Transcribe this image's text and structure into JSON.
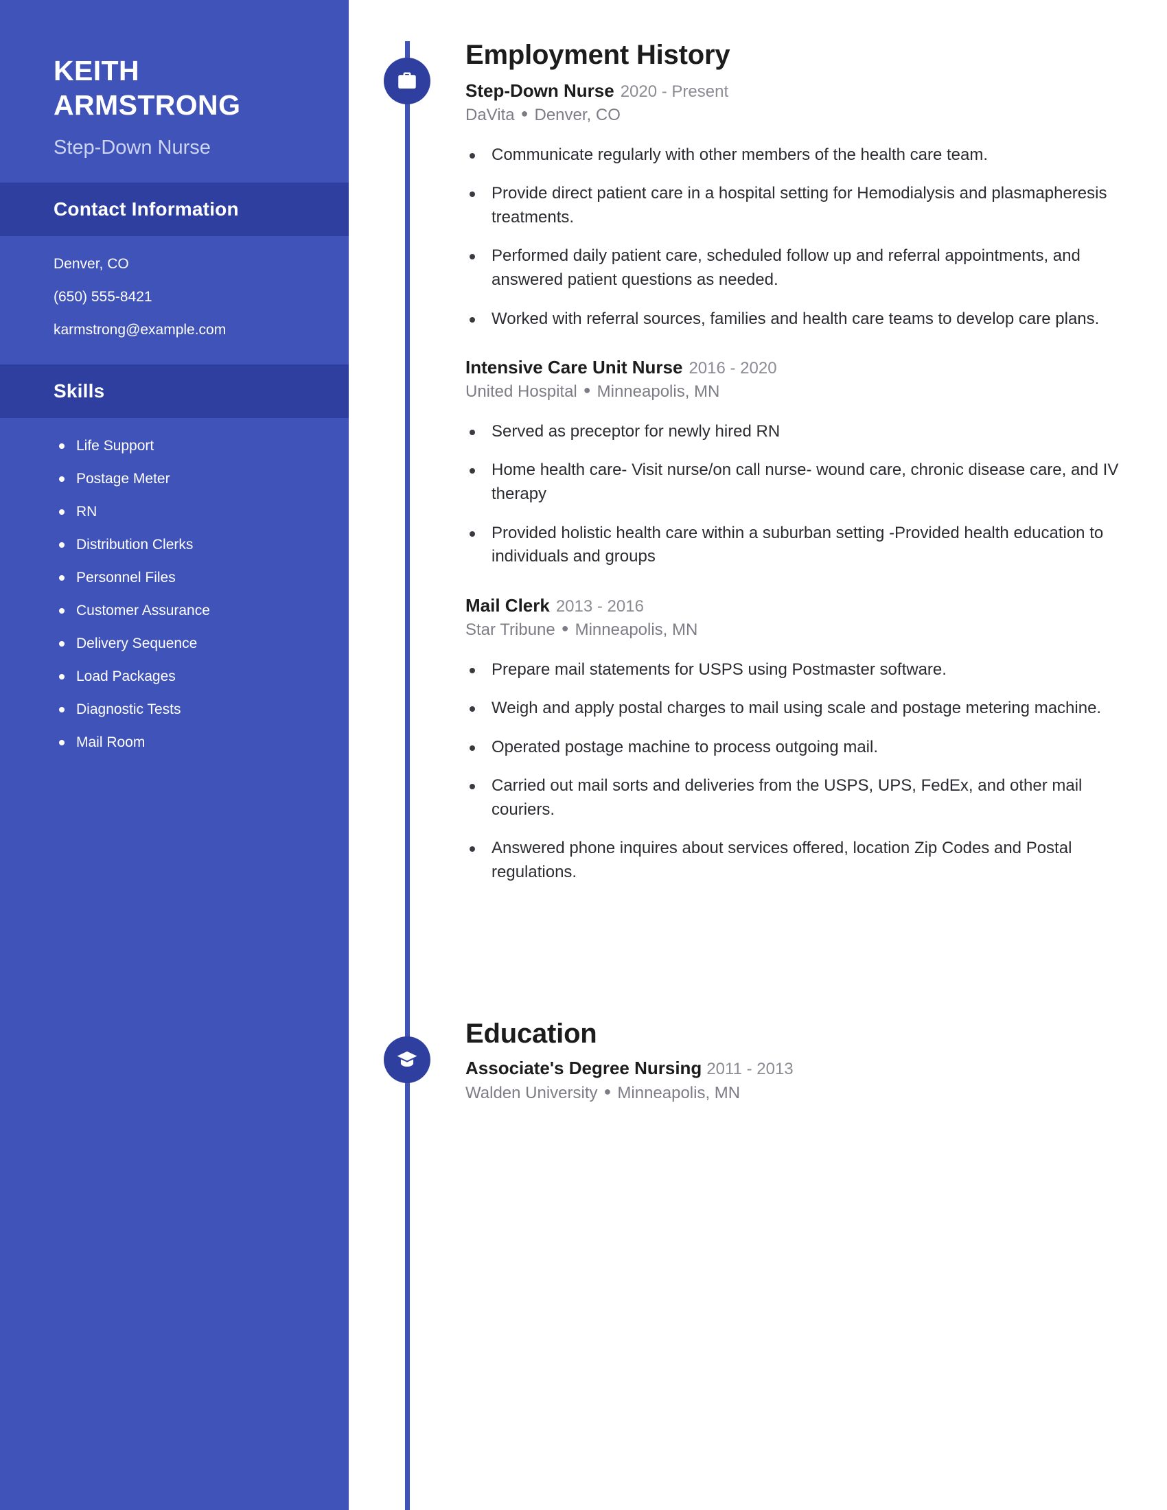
{
  "sidebar": {
    "name": "KEITH ARMSTRONG",
    "name_line_1": "KEITH",
    "name_line_2": "ARMSTRONG",
    "role": "Step-Down Nurse",
    "accent_color": "#4053b8",
    "band_color": "#2f3fa0",
    "contact": {
      "heading": "Contact Information",
      "lines": [
        "Denver, CO",
        "(650) 555-8421",
        "karmstrong@example.com"
      ]
    },
    "skills": {
      "heading": "Skills",
      "items": [
        "Life Support",
        "Postage Meter",
        "RN",
        "Distribution Clerks",
        "Personnel Files",
        "Customer Assurance",
        "Delivery Sequence",
        "Load Packages",
        "Diagnostic Tests",
        "Mail Room"
      ]
    }
  },
  "employment": {
    "heading": "Employment History",
    "icon": "briefcase-icon",
    "jobs": [
      {
        "title": "Step-Down Nurse",
        "dates": "2020 - Present",
        "company": "DaVita",
        "location": "Denver, CO",
        "bullets": [
          "Communicate regularly with other members of the health care team.",
          "Provide direct patient care in a hospital setting for Hemodialysis and plasmapheresis treatments.",
          "Performed daily patient care, scheduled follow up and referral appointments, and answered patient questions as needed.",
          "Worked with referral sources, families and health care teams to develop care plans."
        ]
      },
      {
        "title": "Intensive Care Unit Nurse",
        "dates": "2016 - 2020",
        "company": "United Hospital",
        "location": "Minneapolis, MN",
        "bullets": [
          "Served as preceptor for newly hired RN",
          "Home health care- Visit nurse/on call nurse- wound care, chronic disease care, and IV therapy",
          "Provided holistic health care within a suburban setting -Provided health education to individuals and groups"
        ]
      },
      {
        "title": "Mail Clerk",
        "dates": "2013 - 2016",
        "company": "Star Tribune",
        "location": "Minneapolis, MN",
        "bullets": [
          "Prepare mail statements for USPS using Postmaster software.",
          "Weigh and apply postal charges to mail using scale and postage metering machine.",
          "Operated postage machine to process outgoing mail.",
          "Carried out mail sorts and deliveries from the USPS, UPS, FedEx, and other mail couriers.",
          "Answered phone inquires about services offered, location Zip Codes and Postal regulations."
        ]
      }
    ]
  },
  "education": {
    "heading": "Education",
    "icon": "graduation-cap-icon",
    "entries": [
      {
        "degree": "Associate's Degree Nursing",
        "dates": "2011 - 2013",
        "school": "Walden University",
        "location": "Minneapolis, MN"
      }
    ]
  }
}
